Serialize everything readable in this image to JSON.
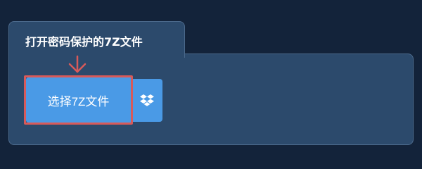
{
  "panel": {
    "title": "打开密码保护的7Z文件"
  },
  "select_button": {
    "label": "选择7Z文件"
  },
  "dropbox_button": {
    "icon": "dropbox-icon"
  },
  "annotation": {
    "arrow_icon": "arrow-down-icon",
    "color": "#d85a5a"
  },
  "colors": {
    "background": "#13233a",
    "panel": "#2c4a6c",
    "button": "#4a9ae6"
  }
}
